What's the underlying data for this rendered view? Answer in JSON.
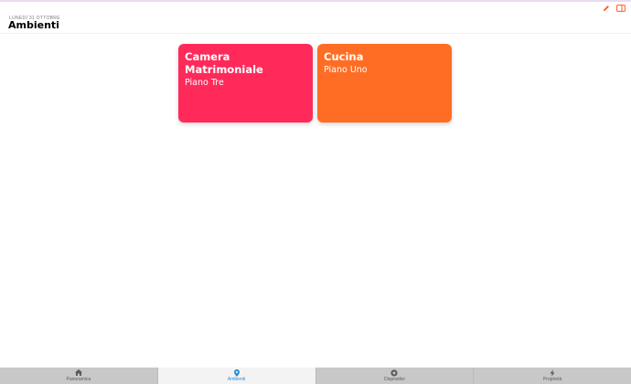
{
  "header": {
    "date": "LUNEDÌ 31 OTTOBRE",
    "title": "Ambienti",
    "actions": [
      {
        "icon": "edit-pencil-icon"
      },
      {
        "icon": "sidebar-panel-icon"
      }
    ],
    "accent_color": "#ff5a1f"
  },
  "rooms": [
    {
      "name": "Camera Matrimoniale",
      "floor": "Piano Tre",
      "color": "#ff2a5a"
    },
    {
      "name": "Cucina",
      "floor": "Piano Uno",
      "color": "#ff6d24"
    }
  ],
  "tabs": [
    {
      "label": "Panoramica",
      "icon": "home-icon",
      "active": false
    },
    {
      "label": "Ambienti",
      "icon": "location-pin-icon",
      "active": true
    },
    {
      "label": "Dispositivi",
      "icon": "devices-icon",
      "active": false
    },
    {
      "label": "Proprietà",
      "icon": "lightning-icon",
      "active": false
    }
  ],
  "colors": {
    "tab_active": "#2b8fd6",
    "tab_inactive": "#5a5a5a",
    "tabbar_bg": "#c8c8c8"
  }
}
